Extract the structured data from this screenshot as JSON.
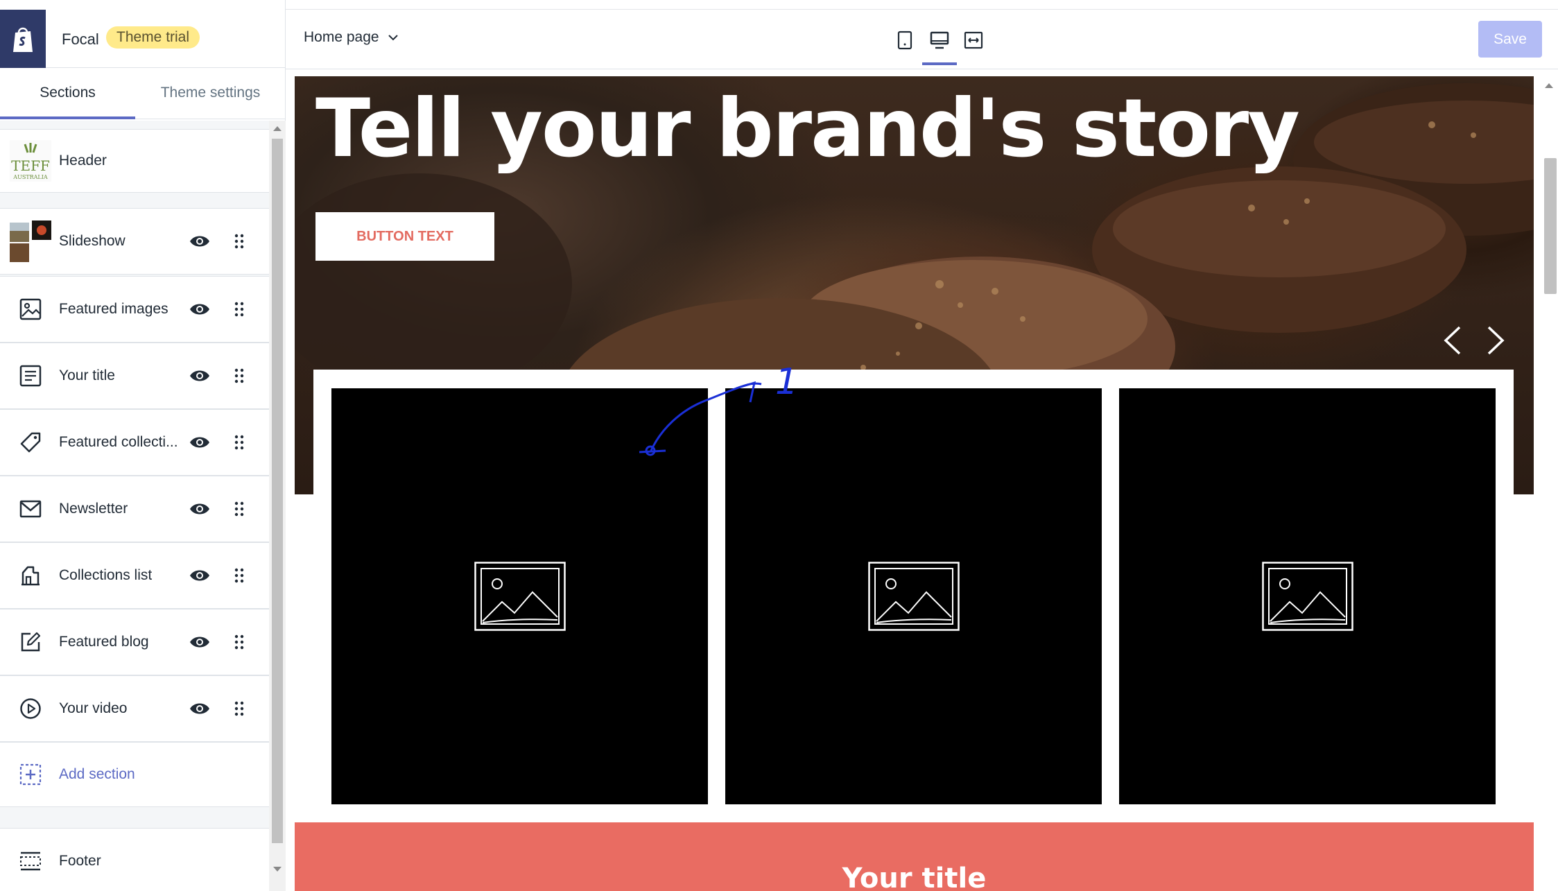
{
  "app": {
    "theme_name": "Focal",
    "trial_badge": "Theme trial"
  },
  "tabs": [
    {
      "label": "Sections",
      "active": true
    },
    {
      "label": "Theme settings",
      "active": false
    }
  ],
  "sections": {
    "header": {
      "label": "Header",
      "thumb_text": "TEFF"
    },
    "items": [
      {
        "label": "Slideshow",
        "icon": "slideshow-thumbnail"
      },
      {
        "label": "Featured images",
        "icon": "image-icon"
      },
      {
        "label": "Your title",
        "icon": "text-icon"
      },
      {
        "label": "Featured collecti...",
        "icon": "tag-icon"
      },
      {
        "label": "Newsletter",
        "icon": "envelope-icon"
      },
      {
        "label": "Collections list",
        "icon": "collections-icon"
      },
      {
        "label": "Featured blog",
        "icon": "blog-edit-icon"
      },
      {
        "label": "Your video",
        "icon": "play-icon"
      }
    ],
    "add_section": "Add section",
    "footer": "Footer"
  },
  "topbar": {
    "page_select": "Home page",
    "save_label": "Save",
    "devices": [
      "mobile",
      "desktop",
      "full-width"
    ],
    "active_device": "desktop"
  },
  "preview": {
    "hero_title": "Tell your brand's story",
    "hero_button": "BUTTON TEXT",
    "title_band": "Your title",
    "annotation_text": "1"
  },
  "colors": {
    "accent": "#5c6ac4",
    "trial_badge": "#ffea8a",
    "save_disabled": "#b3bcf5",
    "title_band": "#e96c62",
    "hero_button_text": "#e36b60",
    "logo_bg": "#2f3a68"
  }
}
